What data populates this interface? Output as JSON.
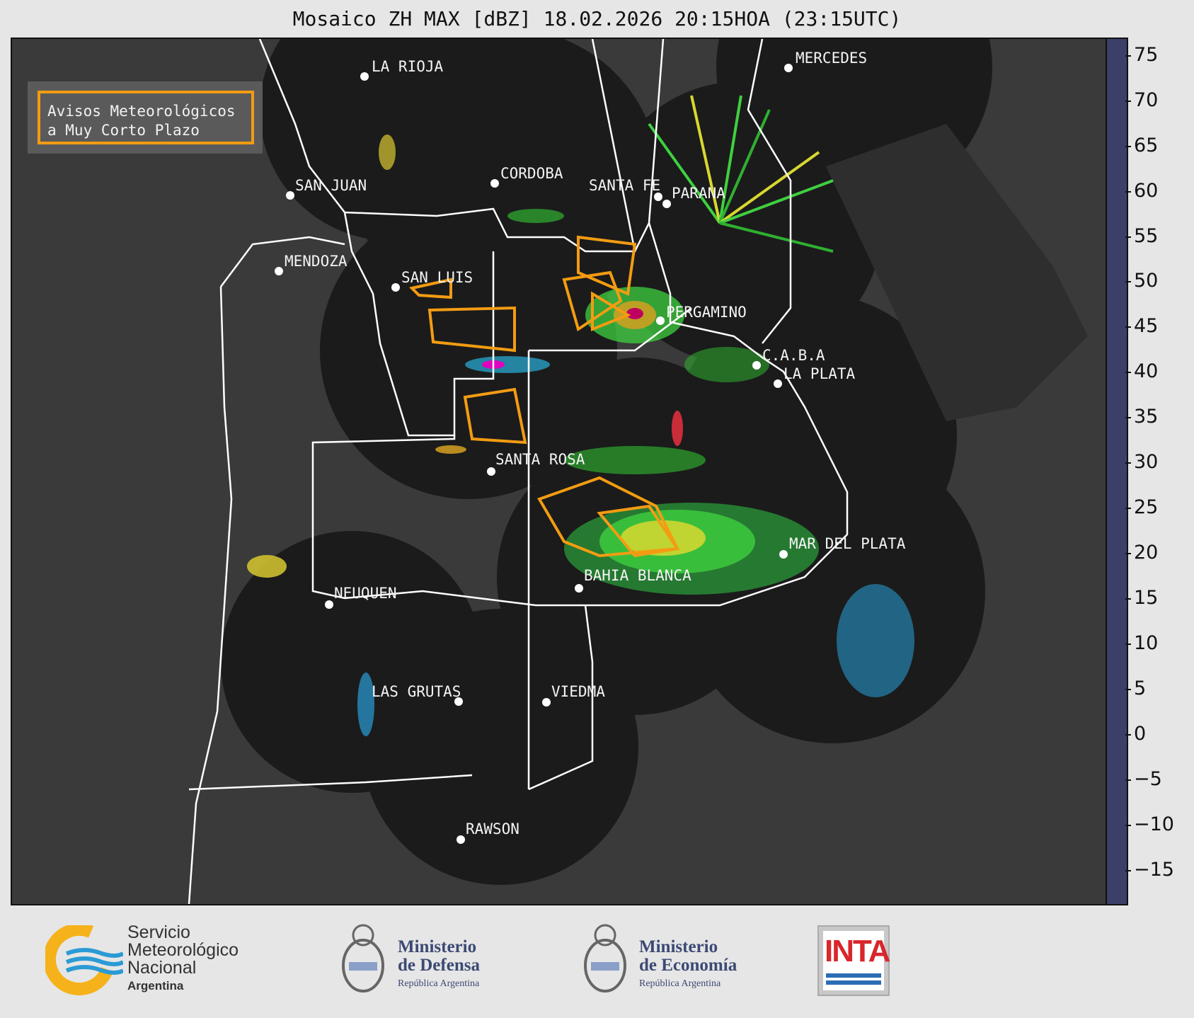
{
  "title": "Mosaico ZH MAX [dBZ] 18.02.2026 20:15HOA (23:15UTC)",
  "legend": {
    "line1": "Avisos Meteorológicos",
    "line2": "a Muy Corto Plazo",
    "border_color": "#f39c12"
  },
  "cities": [
    {
      "name": "LA RIOJA"
    },
    {
      "name": "MERCEDES"
    },
    {
      "name": "SAN JUAN"
    },
    {
      "name": "CORDOBA"
    },
    {
      "name": "SANTA FE"
    },
    {
      "name": "PARANA"
    },
    {
      "name": "MENDOZA"
    },
    {
      "name": "SAN LUIS"
    },
    {
      "name": "PERGAMINO"
    },
    {
      "name": "C.A.B.A"
    },
    {
      "name": "LA PLATA"
    },
    {
      "name": "SANTA ROSA"
    },
    {
      "name": "MAR DEL PLATA"
    },
    {
      "name": "BAHIA BLANCA"
    },
    {
      "name": "NEUQUEN"
    },
    {
      "name": "LAS GRUTAS"
    },
    {
      "name": "VIEDMA"
    },
    {
      "name": "RAWSON"
    }
  ],
  "colorbar": {
    "unit": "dBZ",
    "ticks": [
      "75",
      "70",
      "65",
      "60",
      "55",
      "50",
      "45",
      "40",
      "35",
      "30",
      "25",
      "20",
      "15",
      "10",
      "5",
      "0",
      "−5",
      "−10",
      "−15"
    ],
    "range": [
      -18.5,
      77
    ],
    "colors": [
      "#3a4068",
      "#3a4a7a",
      "#35588c",
      "#2f6aa0",
      "#2a80b8",
      "#2896cc",
      "#2ab0dc",
      "#3fd040",
      "#2fb030",
      "#1d8a22",
      "#e8e830",
      "#d8c830",
      "#d4a020",
      "#e08020",
      "#e83040",
      "#d01020",
      "#a00010",
      "#c00060",
      "#e000c0",
      "#b000b0",
      "#800080",
      "#ffffff",
      "#d8f4ea",
      "#b0ecd6",
      "#90e0c0",
      "#78d8b4"
    ]
  },
  "logos": {
    "smn": {
      "line1": "Servicio",
      "line2": "Meteorológico",
      "line3": "Nacional",
      "line4": "Argentina",
      "color": "#f5b21a",
      "accent": "#2a9bd4"
    },
    "defensa": {
      "line1": "Ministerio",
      "line2": "de Defensa",
      "line3": "República Argentina"
    },
    "economia": {
      "line1": "Ministerio",
      "line2": "de Economía",
      "line3": "República Argentina"
    },
    "inta": {
      "text": "INTA",
      "color": "#d8262c",
      "accent": "#2a6cb5"
    }
  }
}
